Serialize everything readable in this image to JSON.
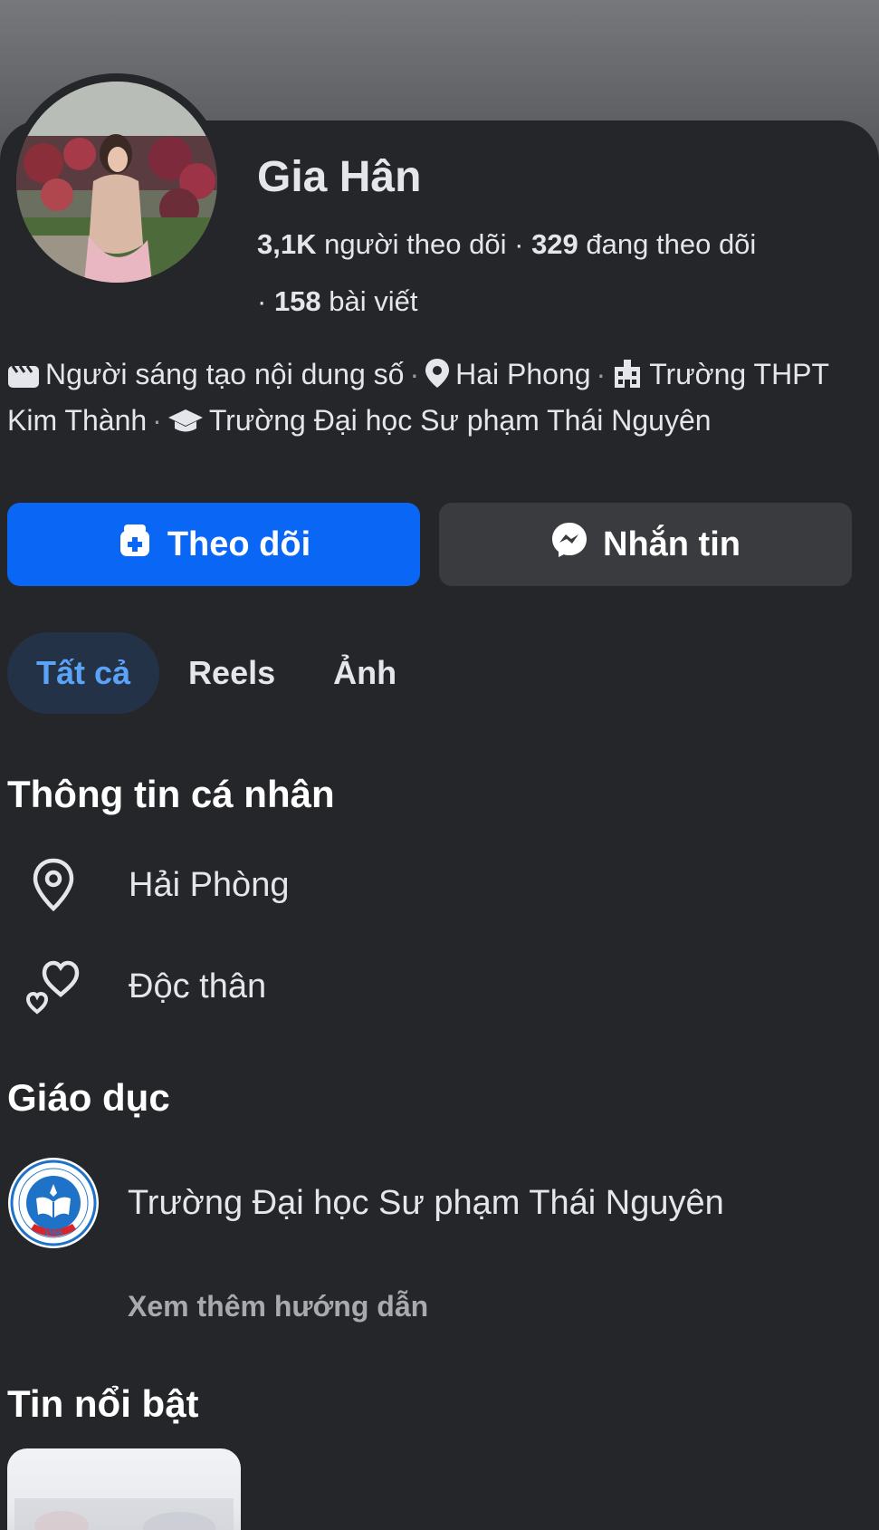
{
  "profile": {
    "name": "Gia Hân",
    "followers_count": "3,1K",
    "followers_label": "người theo dõi",
    "following_count": "329",
    "following_label": "đang theo dõi",
    "posts_count": "158",
    "posts_label": "bài viết"
  },
  "intro": {
    "creator": "Người sáng tạo nội dung số",
    "location": "Hai Phong",
    "high_school": "Trường THPT Kim Thành",
    "university": "Trường Đại học Sư phạm Thái Nguyên"
  },
  "actions": {
    "follow_label": "Theo dõi",
    "message_label": "Nhắn tin"
  },
  "tabs": [
    {
      "label": "Tất cả",
      "active": true
    },
    {
      "label": "Reels",
      "active": false
    },
    {
      "label": "Ảnh",
      "active": false
    }
  ],
  "personal_info": {
    "title": "Thông tin cá nhân",
    "city": "Hải Phòng",
    "relationship": "Độc thân"
  },
  "education": {
    "title": "Giáo dục",
    "school": "Trường Đại học Sư phạm Thái Nguyên",
    "logo_year": "1966",
    "see_more": "Xem thêm hướng dẫn"
  },
  "highlights": {
    "title": "Tin nổi bật"
  },
  "colors": {
    "background": "#252629",
    "accent_blue": "#0a66f5",
    "tab_active_bg": "#233247",
    "tab_active_text": "#5ba3f7"
  },
  "icons": {
    "creator": "clapperboard-icon",
    "location": "map-pin-icon",
    "high_school": "school-building-icon",
    "university": "graduation-cap-icon",
    "follow": "add-user-icon",
    "message": "messenger-icon",
    "city": "map-pin-outline-icon",
    "relationship": "hearts-icon"
  }
}
